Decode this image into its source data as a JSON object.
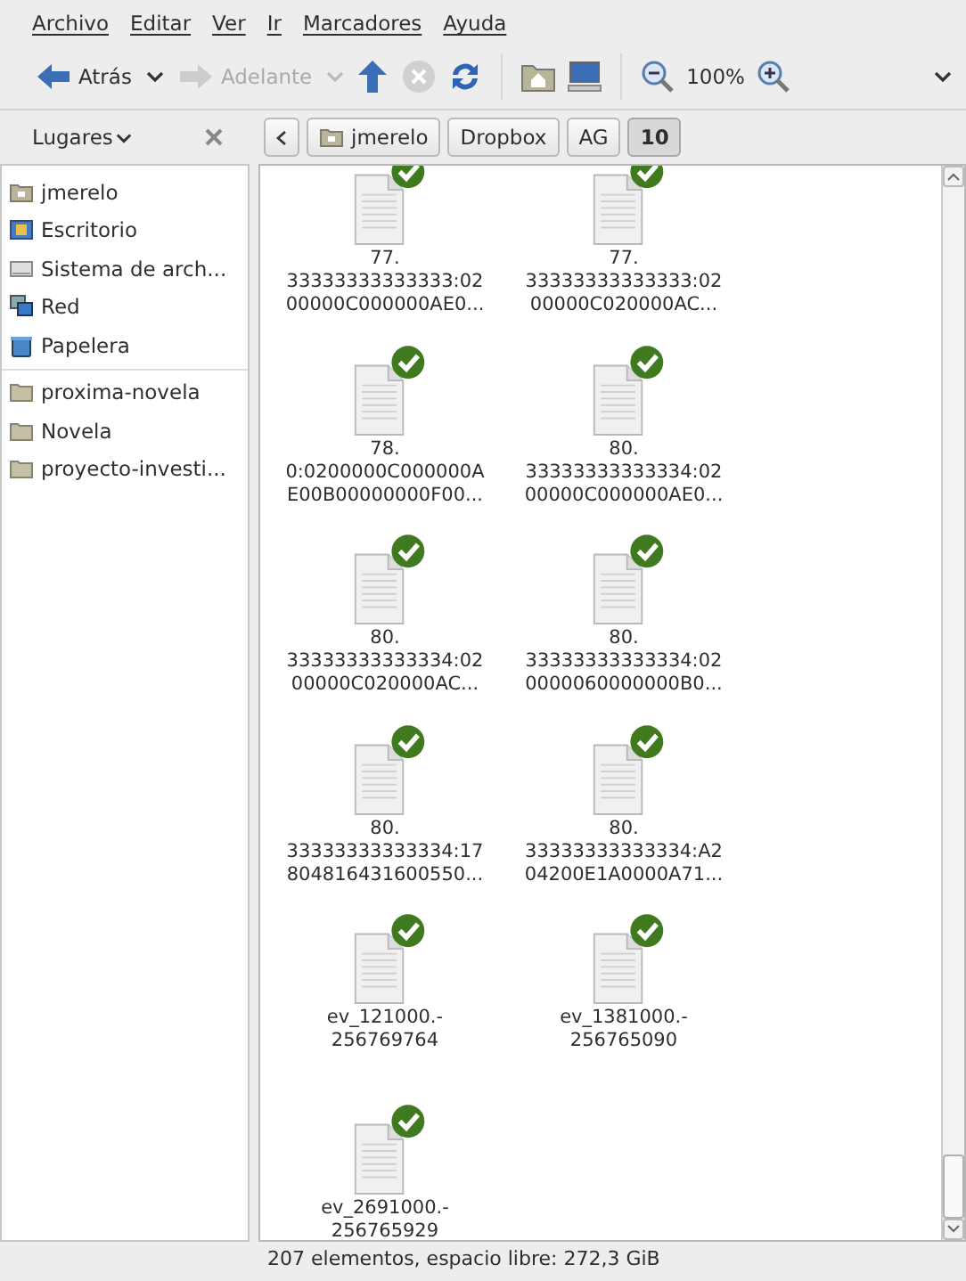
{
  "menu": [
    "Archivo",
    "Editar",
    "Ver",
    "Ir",
    "Marcadores",
    "Ayuda"
  ],
  "toolbar": {
    "back": {
      "label": "Atrás",
      "disabled": false
    },
    "forward": {
      "label": "Adelante",
      "disabled": true
    },
    "stop_disabled": true,
    "zoom": "100%"
  },
  "sidebar": {
    "title": "Lugares",
    "places": [
      {
        "label": "jmerelo",
        "kind": "home"
      },
      {
        "label": "Escritorio",
        "kind": "desktop"
      },
      {
        "label": "Sistema de arch...",
        "kind": "drive"
      },
      {
        "label": "Red",
        "kind": "network"
      },
      {
        "label": "Papelera",
        "kind": "trash"
      }
    ],
    "bookmarks": [
      {
        "label": "proxima-novela",
        "kind": "folder"
      },
      {
        "label": "Novela",
        "kind": "folder"
      },
      {
        "label": "proyecto-investi...",
        "kind": "folder"
      }
    ]
  },
  "pathbar": [
    {
      "label": "jmerelo",
      "kind": "home",
      "selected": false
    },
    {
      "label": "Dropbox",
      "kind": "plain",
      "selected": false
    },
    {
      "label": "AG",
      "kind": "plain",
      "selected": false
    },
    {
      "label": "10",
      "kind": "plain",
      "selected": true
    }
  ],
  "files": [
    {
      "lines": [
        "77.",
        "33333333333333:02",
        "00000C000000AE0..."
      ],
      "synced": true
    },
    {
      "lines": [
        "77.",
        "33333333333333:02",
        "00000C020000AC..."
      ],
      "synced": true
    },
    {
      "lines": [
        "78.",
        "0:0200000C000000A",
        "E00B00000000F00..."
      ],
      "synced": true
    },
    {
      "lines": [
        "80.",
        "33333333333334:02",
        "00000C000000AE0..."
      ],
      "synced": true
    },
    {
      "lines": [
        "80.",
        "33333333333334:02",
        "00000C020000AC..."
      ],
      "synced": true
    },
    {
      "lines": [
        "80.",
        "33333333333334:02",
        "0000060000000B0..."
      ],
      "synced": true
    },
    {
      "lines": [
        "80.",
        "33333333333334:17",
        "804816431600550..."
      ],
      "synced": true
    },
    {
      "lines": [
        "80.",
        "33333333333334:A2",
        "04200E1A0000A71..."
      ],
      "synced": true
    },
    {
      "lines": [
        "ev_121000.-",
        "256769764"
      ],
      "synced": true
    },
    {
      "lines": [
        "ev_1381000.-",
        "256765090"
      ],
      "synced": true
    },
    {
      "lines": [
        "ev_2691000.-",
        "256765929"
      ],
      "synced": true
    }
  ],
  "status_bar": "207 elementos, espacio libre: 272,3 GiB"
}
